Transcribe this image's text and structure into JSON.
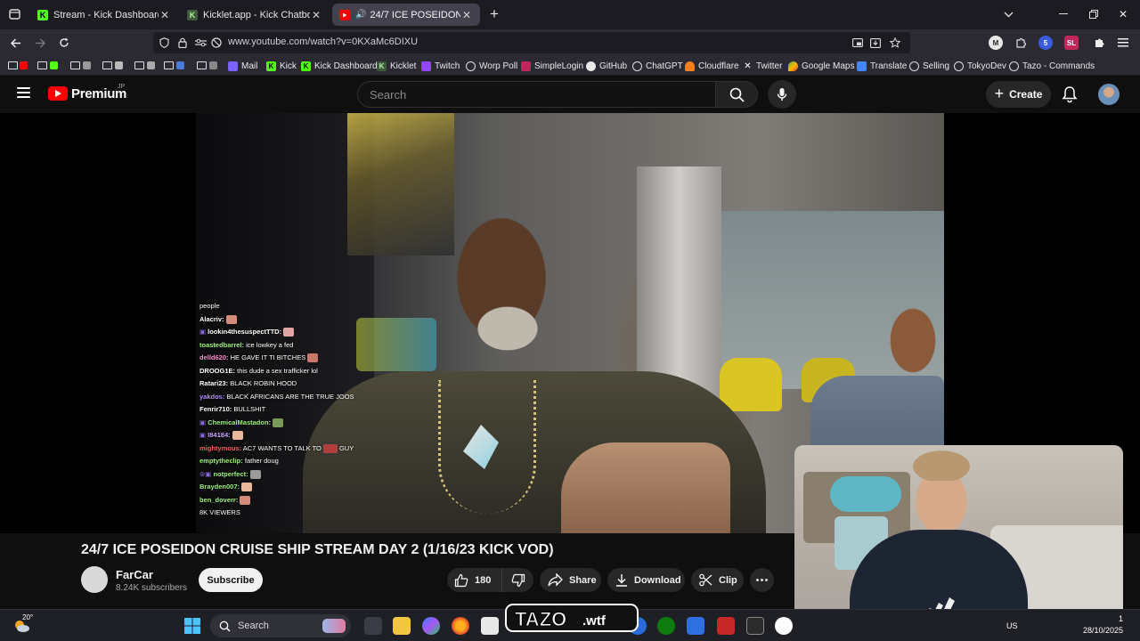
{
  "browser": {
    "tabs": [
      {
        "title": "Stream - Kick Dashboard",
        "icon": "kick-icon",
        "active": false
      },
      {
        "title": "Kicklet.app - Kick Chatbot and",
        "icon": "kicklet-icon",
        "active": false
      },
      {
        "title": "24/7 ICE POSEIDON CRUISE",
        "icon": "youtube-icon",
        "active": true
      }
    ],
    "url": "www.youtube.com/watch?v=0KXaMc6DIXU",
    "extensions": [
      "M",
      "5",
      "SL"
    ],
    "bookmarks": [
      "Mail",
      "Kick",
      "Kick Dashboard",
      "Kicklet",
      "Twitch",
      "Worp Poll",
      "SimpleLogin",
      "GitHub",
      "ChatGPT",
      "Cloudflare",
      "Twitter",
      "Google Maps",
      "Translate",
      "Selling",
      "TokyoDev",
      "Tazo - Commands"
    ]
  },
  "youtube": {
    "brand": "Premium",
    "region": "JP",
    "search_placeholder": "Search",
    "create_label": "Create",
    "colors": {
      "brand_red": "#ff0000",
      "bg": "#0f0f0f"
    }
  },
  "chat": {
    "lines": [
      {
        "user": "",
        "msg": "people",
        "color": "#ffffff"
      },
      {
        "user": "Alacriv:",
        "msg": "",
        "color": "#ffffff",
        "emote": true
      },
      {
        "user": "lookin4thesuspectTTD:",
        "msg": "",
        "color": "#c9a6ff",
        "emote": true
      },
      {
        "user": "toastedbarrel:",
        "msg": "ice lowkey a fed",
        "color": "#9cf27a"
      },
      {
        "user": "delld620:",
        "msg": "HE GAVE IT TI BITCHES",
        "color": "#ff8fd0",
        "emote": true
      },
      {
        "user": "DROOG1E:",
        "msg": "this dude a sex trafficker lol",
        "color": "#ffffff"
      },
      {
        "user": "Ratari23:",
        "msg": "BLACK ROBIN HOOD",
        "color": "#ffffff"
      },
      {
        "user": "yakdos:",
        "msg": "BLACK AFRICANS ARE THE TRUE JOOS",
        "color": "#a98bff"
      },
      {
        "user": "Fenrir710:",
        "msg": "BULLSHIT",
        "color": "#ffffff"
      },
      {
        "user": "ChemicalMastadon:",
        "msg": "",
        "color": "#9cf27a",
        "emote": true
      },
      {
        "user": "I84184:",
        "msg": "",
        "color": "#c9a6ff",
        "emote": true
      },
      {
        "user": "mightymous:",
        "msg": "AC7 WANTS TO TALK TO",
        "color": "#ff5c5c",
        "tail": "GUY"
      },
      {
        "user": "emptytheclip:",
        "msg": "father doug",
        "color": "#9cf27a"
      },
      {
        "user": "notperfect:",
        "msg": "",
        "color": "#9cf27a",
        "emote": true
      },
      {
        "user": "Brayden007:",
        "msg": "",
        "color": "#9cf27a",
        "emote": true
      },
      {
        "user": "ben_doverr:",
        "msg": "",
        "color": "#9cf27a",
        "emote": true
      },
      {
        "user": "",
        "msg": "8K VIEWERS",
        "color": "#ffffff"
      }
    ]
  },
  "video": {
    "title": "24/7 ICE POSEIDON CRUISE SHIP STREAM DAY 2 (1/16/23 KICK VOD)",
    "channel": "FarCar",
    "subscribers": "8.24K subscribers",
    "subscribe_label": "Subscribe",
    "likes": "180",
    "share_label": "Share",
    "download_label": "Download",
    "clip_label": "Clip"
  },
  "overlay": {
    "brand": "TAZO.wtf"
  },
  "taskbar": {
    "weather": "20°",
    "search_label": "Search",
    "lang": "US",
    "date": "28/10/2025",
    "time": "1"
  }
}
